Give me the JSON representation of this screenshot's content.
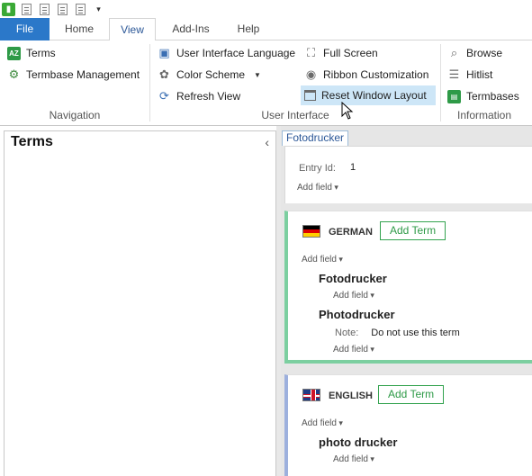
{
  "qat": {
    "app_icon": "app-logo-icon",
    "icons": [
      "new-document-icon",
      "edit-document-icon",
      "save-document-icon",
      "print-document-icon"
    ],
    "dropdown": "▾"
  },
  "tabs": [
    {
      "label": "File"
    },
    {
      "label": "Home"
    },
    {
      "label": "View",
      "active": true
    },
    {
      "label": "Add-Ins"
    },
    {
      "label": "Help"
    }
  ],
  "ribbon": {
    "navigation": {
      "label": "Navigation",
      "items": [
        {
          "label": "Terms",
          "icon": "terms-icon"
        },
        {
          "label": "Termbase Management",
          "icon": "termbase-management-icon"
        }
      ]
    },
    "user_interface": {
      "label": "User Interface",
      "items": [
        {
          "label": "User Interface Language",
          "icon": "language-icon"
        },
        {
          "label": "Color Scheme",
          "icon": "palette-icon"
        },
        {
          "label": "Refresh View",
          "icon": "refresh-icon"
        },
        {
          "label": "Full Screen",
          "icon": "full-screen-icon"
        },
        {
          "label": "Ribbon Customization",
          "icon": "eye-icon"
        },
        {
          "label": "Reset Window Layout",
          "icon": "reset-layout-icon"
        }
      ]
    },
    "information": {
      "label": "Information",
      "items": [
        {
          "label": "Browse",
          "icon": "browse-icon"
        },
        {
          "label": "Hitlist",
          "icon": "hitlist-icon"
        },
        {
          "label": "Termbases",
          "icon": "termbases-icon"
        }
      ]
    }
  },
  "left_panel": {
    "title": "Terms",
    "collapse": "‹"
  },
  "document_tab": "Fotodrucker",
  "entry": {
    "id_label": "Entry Id:",
    "id_value": "1",
    "add_field": "Add field"
  },
  "languages": [
    {
      "name": "GERMAN",
      "add_term": "Add Term",
      "add_field": "Add field",
      "terms": [
        {
          "term": "Fotodrucker",
          "add_field": "Add field"
        },
        {
          "term": "Photodrucker",
          "note_label": "Note:",
          "note_value": "Do not use this term",
          "add_field": "Add field"
        }
      ]
    },
    {
      "name": "ENGLISH",
      "add_term": "Add Term",
      "add_field": "Add field",
      "terms": [
        {
          "term": "photo drucker",
          "add_field": "Add field"
        }
      ]
    }
  ],
  "colors": {
    "file_tab": "#2b78c9",
    "german_accent": "#7ccfa0",
    "english_accent": "#9db0dd",
    "add_term": "#2e9a47",
    "hover": "#cde6f7"
  }
}
